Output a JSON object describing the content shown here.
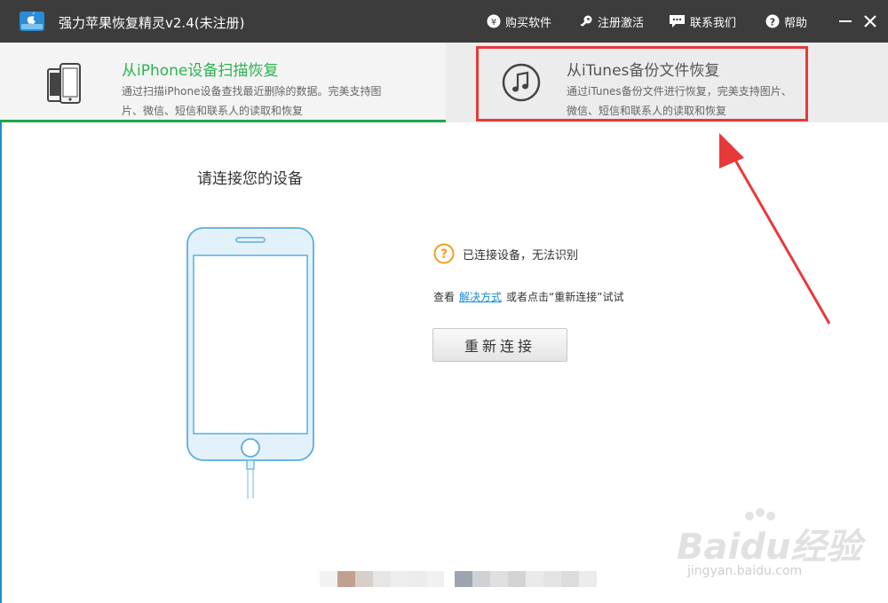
{
  "app": {
    "title": "强力苹果恢复精灵v2.4(未注册)"
  },
  "titlebar": {
    "buy_label": "购买软件",
    "buy_icon": "yen-icon",
    "register_label": "注册激活",
    "register_icon": "key-icon",
    "contact_label": "联系我们",
    "contact_icon": "chat-icon",
    "help_label": "帮助",
    "help_icon": "question-icon"
  },
  "tabs": [
    {
      "title": "从iPhone设备扫描恢复",
      "desc": "通过扫描iPhone设备查找最近删除的数据。完美支持图片、微信、短信和联系人的读取和恢复",
      "active": true
    },
    {
      "title": "从iTunes备份文件恢复",
      "desc": "通过iTunes备份文件进行恢复，完美支持图片、微信、短信和联系人的读取和恢复",
      "active": false
    }
  ],
  "main": {
    "connect_title": "请连接您的设备",
    "warning_text": "已连接设备，无法识别",
    "help_prefix": "查看",
    "help_link": "解决方式",
    "help_suffix": "或者点击“重新连接”试试",
    "reconnect_label": "重新连接"
  },
  "watermark": {
    "main": "Baidu经验",
    "sub": "jingyan.baidu.com"
  },
  "colors": {
    "titlebar_bg": "#3c3c3c",
    "accent_green": "#2db352",
    "link_blue": "#1a8ad4",
    "device_blue": "#5aaee0",
    "warning_orange": "#f0a020",
    "annotation_red": "#e8393a"
  }
}
